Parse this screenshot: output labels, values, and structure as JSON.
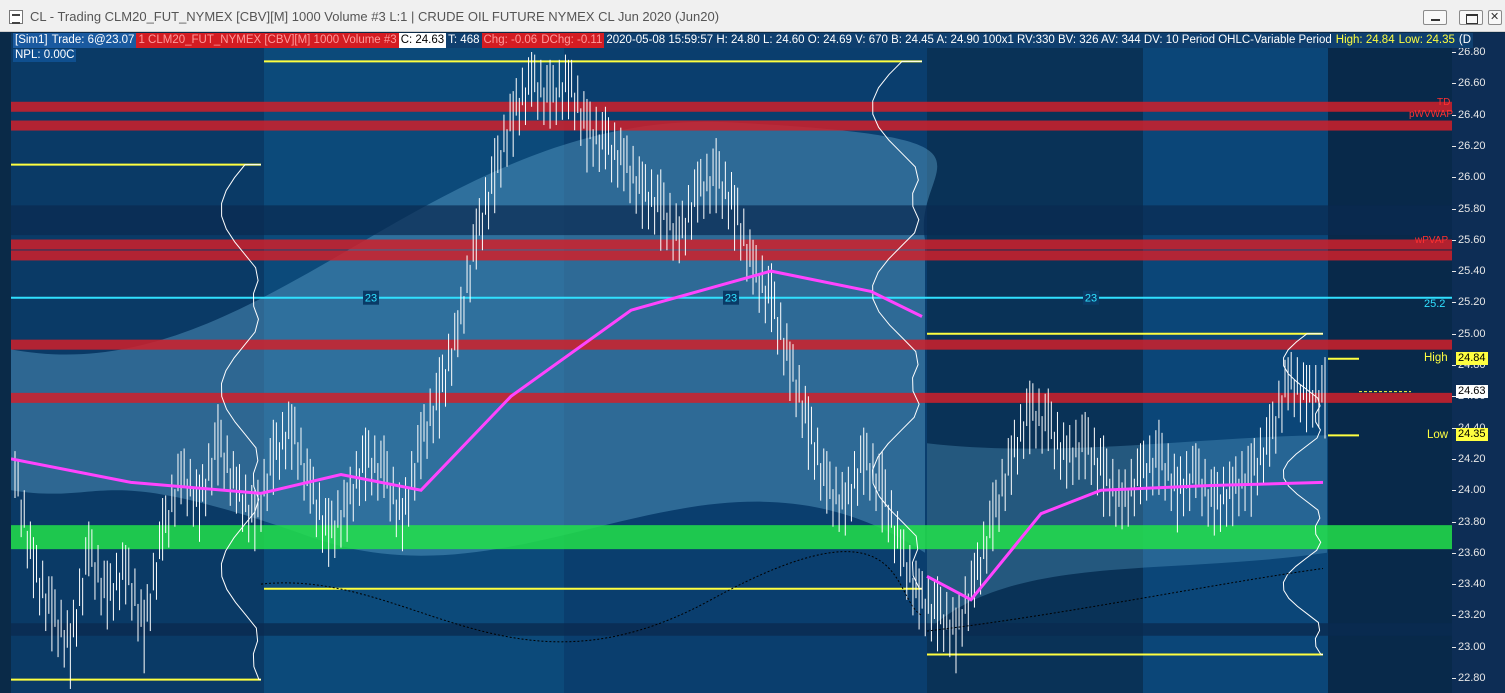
{
  "window": {
    "title": "CL - Trading  CLM20_FUT_NYMEX [CBV][M]  1000 Volume  #3  L:1 | CRUDE OIL FUTURE NYMEX CL Jun 2020 (Jun20)",
    "minimize_icon": "minimize-icon",
    "maximize_icon": "restore-icon",
    "close_icon": "close-icon"
  },
  "header": {
    "account": "[Sim1]",
    "trade": "Trade: 6@23.07",
    "symbol": "1 CLM20_FUT_NYMEX [CBV][M]  1000 Volume  #3",
    "last": "C: 24.63",
    "trades": "T: 468",
    "chg": "Chg: -0.06",
    "dchg": "DChg: -0.11",
    "bar_info": "2020-05-08 15:59:57 H: 24.80 L: 24.60 O: 24.69 V: 670 B: 24.45 A: 24.90 100x1 RV:330 BV: 326 AV: 344 DV: 10 Period OHLC-Variable Period",
    "high": "High: 24.84",
    "low": "Low: 24.35",
    "trailing": "(D",
    "npl": "NPL: 0.00C"
  },
  "colors": {
    "background": "#0a2a48",
    "band_red": "#d0202a",
    "band_green": "#22e04a",
    "ma_line": "#ff44ff",
    "yellow": "#ffff40",
    "cyan": "#30e0ff",
    "candle": "#ffffff"
  },
  "chart_data": {
    "type": "candlestick",
    "instrument": "CLM20_FUT_NYMEX",
    "bar_type": "1000 Volume",
    "ylim": [
      22.75,
      26.87
    ],
    "y_ticks": [
      "26.80",
      "26.60",
      "26.40",
      "26.20",
      "26.00",
      "25.80",
      "25.60",
      "25.40",
      "25.20",
      "25.00",
      "24.80",
      "24.60",
      "24.40",
      "24.20",
      "24.00",
      "23.80",
      "23.60",
      "23.40",
      "23.20",
      "23.00",
      "22.80"
    ],
    "red_levels": [
      26.45,
      26.33,
      25.57,
      25.5,
      24.93,
      24.59
    ],
    "green_level": 23.7,
    "cyan_level": 25.23,
    "cyan_label": "23",
    "cyan_right_label": "25.2",
    "current_price": "24.63",
    "high_label": "High",
    "high_value": "24.84",
    "low_label": "Low",
    "low_value": "24.35",
    "side_labels": [
      "TD",
      "pWVWAP",
      "wPVAP"
    ],
    "sessions": [
      {
        "high": 26.08,
        "low": 22.79,
        "ma_start": 24.2,
        "ma_end": 23.98
      },
      {
        "high": 26.74,
        "low": 23.37,
        "ma_start": 23.98,
        "ma_end": 25.11
      },
      {
        "high": 25.0,
        "low": 22.95,
        "ma_start": 23.4,
        "ma_end": 24.05
      },
      {
        "high": 24.84,
        "low": 24.35,
        "ma_start": 24.7,
        "ma_end": 24.6
      }
    ],
    "price_path": [
      24.1,
      23.5,
      23.2,
      23.0,
      23.6,
      23.3,
      23.5,
      23.1,
      23.7,
      24.1,
      23.9,
      24.3,
      24.0,
      23.8,
      24.2,
      24.4,
      24.0,
      23.7,
      23.9,
      24.2,
      24.1,
      23.8,
      24.3,
      24.6,
      25.0,
      25.6,
      26.0,
      26.4,
      26.6,
      26.5,
      26.6,
      26.3,
      26.2,
      26.1,
      25.9,
      25.8,
      25.6,
      25.9,
      26.0,
      25.8,
      25.4,
      25.2,
      24.8,
      24.4,
      24.0,
      23.9,
      24.2,
      24.0,
      23.6,
      23.3,
      23.2,
      23.1,
      23.4,
      23.8,
      24.2,
      24.5,
      24.4,
      24.2,
      24.3,
      24.1,
      23.9,
      24.1,
      24.2,
      24.0,
      24.1,
      23.9,
      24.0,
      24.1,
      24.3,
      24.7,
      24.6,
      24.6
    ]
  }
}
